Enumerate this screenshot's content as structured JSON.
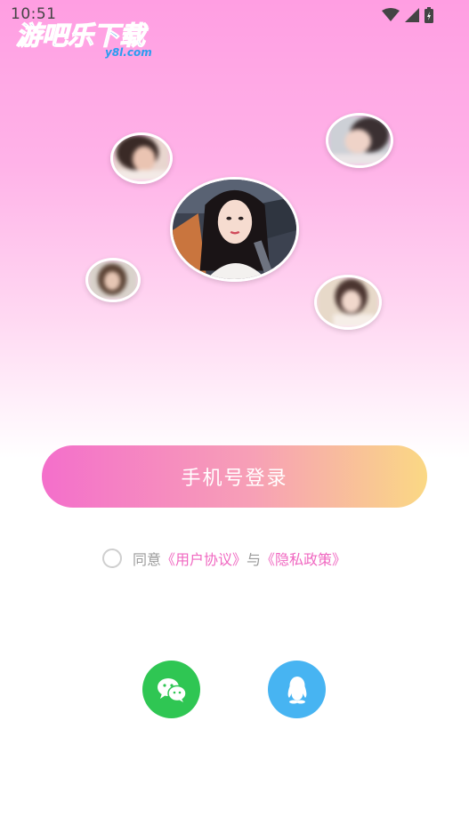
{
  "status_bar": {
    "time": "10:51"
  },
  "watermark": {
    "title": "游吧乐下载",
    "subtitle": "y8l.com"
  },
  "login": {
    "phone_button": "手机号登录"
  },
  "agreement": {
    "prefix": "同意",
    "user_agreement": "《用户协议》",
    "conjunction": "与",
    "privacy_policy": "《隐私政策》"
  },
  "social_login": [
    {
      "icon": "wechat-icon",
      "color": "#2fc653"
    },
    {
      "icon": "qq-icon",
      "color": "#47b4f2"
    }
  ],
  "colors": {
    "accent_pink": "#f46fcb",
    "accent_yellow": "#fad884",
    "link": "#f068c1"
  }
}
